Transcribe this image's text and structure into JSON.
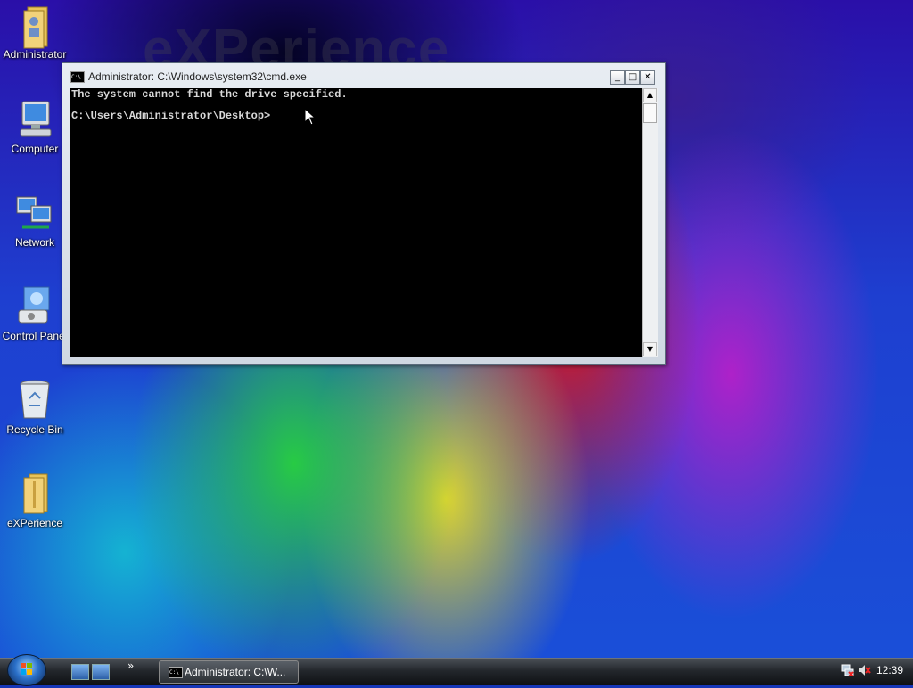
{
  "wallpaper": {
    "logo_text": "eXPerience"
  },
  "desktop": {
    "icons": [
      {
        "label": "Administrator",
        "icon": "user-folder-icon"
      },
      {
        "label": "Computer",
        "icon": "computer-icon"
      },
      {
        "label": "Network",
        "icon": "network-icon"
      },
      {
        "label": "Control Panel",
        "icon": "control-panel-icon"
      },
      {
        "label": "Recycle Bin",
        "icon": "recycle-bin-icon"
      },
      {
        "label": "eXPerience",
        "icon": "folder-icon"
      }
    ]
  },
  "cmd_window": {
    "title": "Administrator: C:\\Windows\\system32\\cmd.exe",
    "icon_text": "C:\\",
    "controls": {
      "minimize": "_",
      "maximize": "□",
      "close": "✕"
    },
    "lines": [
      "The system cannot find the drive specified.",
      "",
      "C:\\Users\\Administrator\\Desktop>"
    ],
    "colors": {
      "background": "#000000",
      "text": "#d8d8d8"
    }
  },
  "taskbar": {
    "quick_launch_more": "»",
    "task_button_label": "Administrator: C:\\W...",
    "task_button_icon_text": "C:\\",
    "clock": "12:39"
  }
}
